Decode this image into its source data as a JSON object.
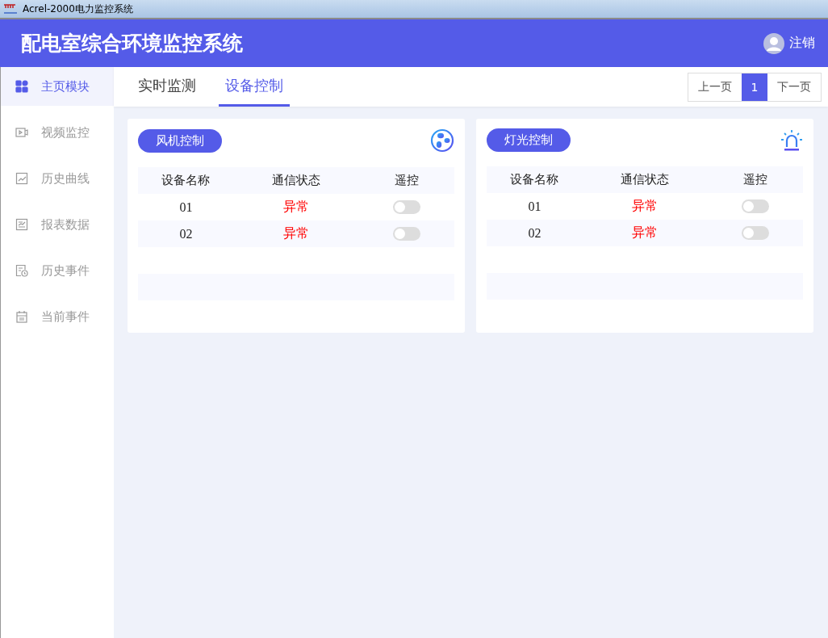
{
  "window": {
    "title": "Acrel-2000电力监控系统"
  },
  "header": {
    "title": "配电室综合环境监控系统",
    "logout": "注销"
  },
  "sidebar": {
    "items": [
      {
        "label": "主页模块",
        "kind": "grid",
        "selected": true
      },
      {
        "label": "视频监控",
        "kind": "video",
        "selected": false
      },
      {
        "label": "历史曲线",
        "kind": "chart",
        "selected": false
      },
      {
        "label": "报表数据",
        "kind": "report",
        "selected": false
      },
      {
        "label": "历史事件",
        "kind": "history",
        "selected": false
      },
      {
        "label": "当前事件",
        "kind": "calendar",
        "selected": false
      }
    ]
  },
  "tabs": [
    {
      "label": "实时监测",
      "selected": false
    },
    {
      "label": "设备控制",
      "selected": true
    }
  ],
  "pager": {
    "prev": "上一页",
    "pages": [
      {
        "label": "1",
        "selected": true
      }
    ],
    "next": "下一页"
  },
  "panels": [
    {
      "title": "风机控制",
      "kind": "fan",
      "columns": [
        "设备名称",
        "通信状态",
        "遥控"
      ],
      "rows": [
        {
          "name": "01",
          "status": "异常",
          "abnormal": true,
          "on": false
        },
        {
          "name": "02",
          "status": "异常",
          "abnormal": true,
          "on": false
        }
      ]
    },
    {
      "title": "灯光控制",
      "kind": "alarm",
      "columns": [
        "设备名称",
        "通信状态",
        "遥控"
      ],
      "rows": [
        {
          "name": "01",
          "status": "异常",
          "abnormal": true,
          "on": false
        },
        {
          "name": "02",
          "status": "异常",
          "abnormal": true,
          "on": false
        }
      ]
    }
  ]
}
